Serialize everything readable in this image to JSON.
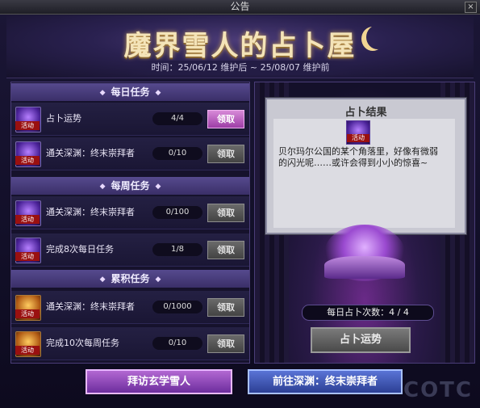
{
  "window": {
    "title": "公告",
    "close_label": "×"
  },
  "banner": {
    "title": "魔界雪人的占卜屋",
    "time_range": "时间：25/06/12 维护后 ~ 25/08/07 维护前"
  },
  "sections": [
    {
      "title": "每日任务"
    },
    {
      "title": "每周任务"
    },
    {
      "title": "累积任务"
    }
  ],
  "tasks": [
    {
      "name": "占卜运势",
      "progress": "4/4",
      "claim": "领取",
      "icon_tag": "活动",
      "icon": "purple-orb-icon"
    },
    {
      "name": "通关深渊：终末崇拜者",
      "progress": "0/10",
      "claim": "领取",
      "icon_tag": "活动",
      "icon": "purple-orb-icon"
    },
    {
      "name": "通关深渊：终末崇拜者",
      "progress": "0/100",
      "claim": "领取",
      "icon_tag": "活动",
      "icon": "purple-orb-icon"
    },
    {
      "name": "完成8次每日任务",
      "progress": "1/8",
      "claim": "领取",
      "icon_tag": "活动",
      "icon": "purple-orb-icon"
    },
    {
      "name": "通关深渊：终末崇拜者",
      "progress": "0/1000",
      "claim": "领取",
      "icon_tag": "活动",
      "icon": "gold-orb-icon"
    },
    {
      "name": "完成10次每周任务",
      "progress": "0/10",
      "claim": "领取",
      "icon_tag": "活动",
      "icon": "gold-orb-icon"
    }
  ],
  "result": {
    "title": "占卜结果",
    "icon_tag": "活动",
    "text": "贝尔玛尔公国的某个角落里，好像有微弱的闪光呢……或许会得到小小的惊喜~"
  },
  "divination": {
    "count_label": "每日占卜次数：4 / 4",
    "button_label": "占卜运势"
  },
  "bottom": {
    "visit_label": "拜访玄学雪人",
    "goto_label": "前往深渊：终末崇拜者"
  },
  "watermark": "COTC",
  "colors": {
    "claim_active": "#c166c8",
    "visit_button": "#8e45b8",
    "goto_button": "#3f57b8"
  }
}
